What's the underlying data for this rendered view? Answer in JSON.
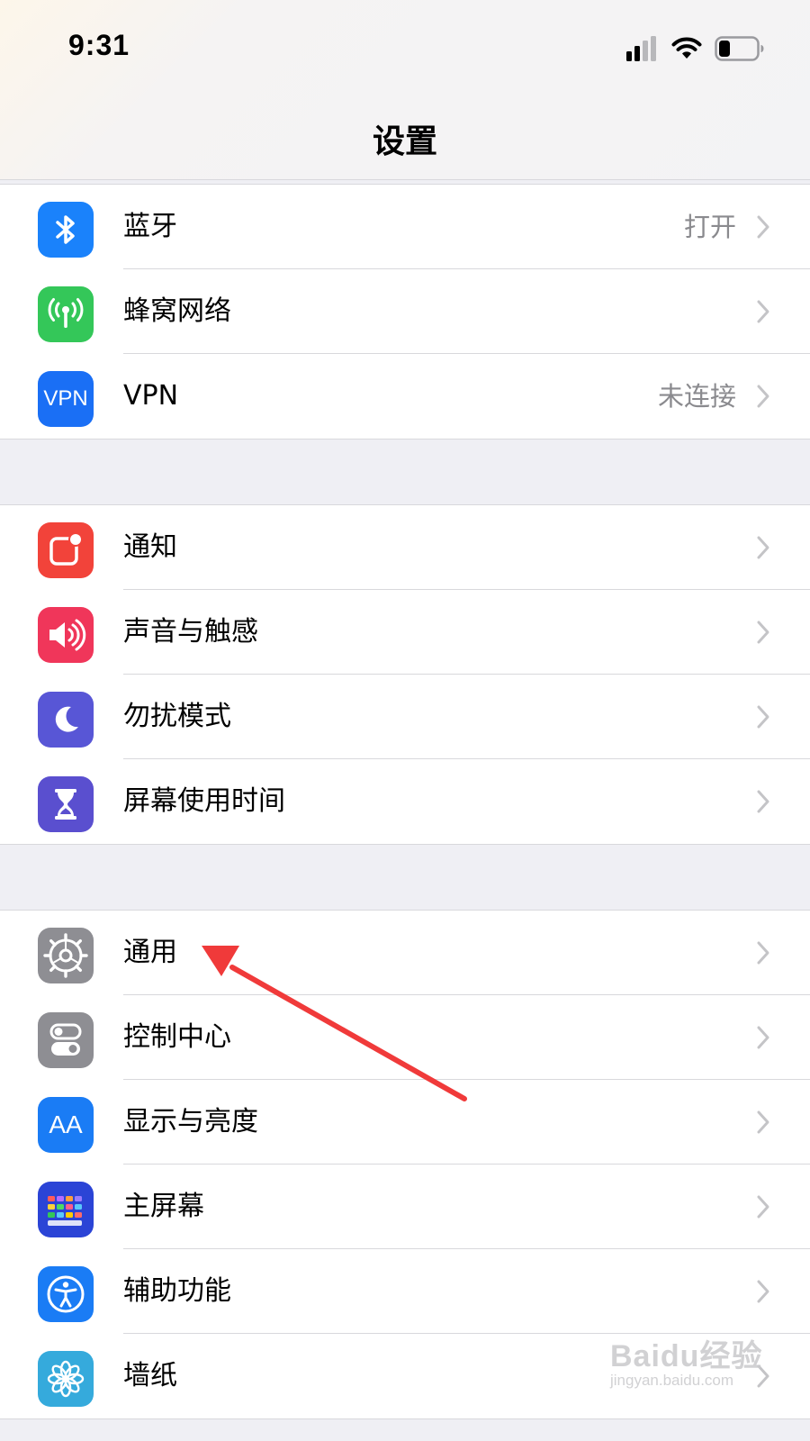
{
  "status_bar": {
    "time": "9:31",
    "battery_level": 0.3
  },
  "nav": {
    "title": "设置"
  },
  "groups": [
    {
      "items": [
        {
          "label": "蓝牙",
          "value": "打开",
          "icon": "bluetooth-icon",
          "color": "#1a82fb"
        },
        {
          "label": "蜂窝网络",
          "value": "",
          "icon": "cellular-antenna-icon",
          "color": "#34c759"
        },
        {
          "label": "VPN",
          "value": "未连接",
          "icon": "vpn-icon",
          "icon_text": "VPN",
          "color": "#1a6ff5"
        }
      ]
    },
    {
      "items": [
        {
          "label": "通知",
          "value": "",
          "icon": "notification-icon",
          "color": "#f2433a"
        },
        {
          "label": "声音与触感",
          "value": "",
          "icon": "speaker-icon",
          "color": "#f0365a"
        },
        {
          "label": "勿扰模式",
          "value": "",
          "icon": "moon-icon",
          "color": "#5856d6"
        },
        {
          "label": "屏幕使用时间",
          "value": "",
          "icon": "hourglass-icon",
          "color": "#5a4fcf"
        }
      ]
    },
    {
      "items": [
        {
          "label": "通用",
          "value": "",
          "icon": "gear-icon",
          "color": "#8e8e93"
        },
        {
          "label": "控制中心",
          "value": "",
          "icon": "toggles-icon",
          "color": "#8e8e93"
        },
        {
          "label": "显示与亮度",
          "value": "",
          "icon": "text-size-icon",
          "icon_text": "AA",
          "color": "#1a7cf5"
        },
        {
          "label": "主屏幕",
          "value": "",
          "icon": "home-screen-grid-icon",
          "color": "#2b44d6"
        },
        {
          "label": "辅助功能",
          "value": "",
          "icon": "accessibility-icon",
          "color": "#1a7cf5"
        },
        {
          "label": "墙纸",
          "value": "",
          "icon": "flower-icon",
          "color": "#35aadc"
        }
      ]
    }
  ],
  "watermark": {
    "main": "Baidu经验",
    "sub": "jingyan.baidu.com"
  },
  "colors": {
    "annotation_arrow": "#f03a3a",
    "chevron": "#c4c4c7",
    "separator": "#d8d8dc"
  }
}
